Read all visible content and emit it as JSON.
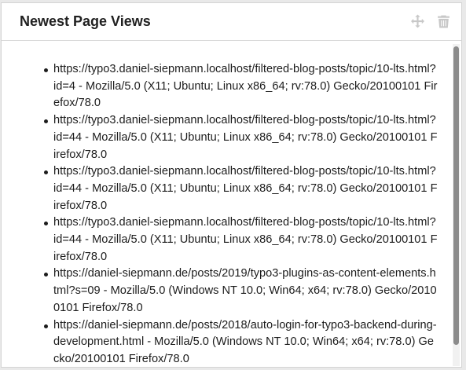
{
  "widget": {
    "title": "Newest Page Views",
    "actions": [
      {
        "name": "move",
        "icon": "move-icon"
      },
      {
        "name": "remove",
        "icon": "trash-icon"
      }
    ]
  },
  "entries": [
    "https://typo3.daniel-siepmann.localhost/filtered-blog-posts/topic/10-lts.html?id=4 - Mozilla/5.0 (X11; Ubuntu; Linux x86_64; rv:78.0) Gecko/20100101 Firefox/78.0",
    "https://typo3.daniel-siepmann.localhost/filtered-blog-posts/topic/10-lts.html?id=44 - Mozilla/5.0 (X11; Ubuntu; Linux x86_64; rv:78.0) Gecko/20100101 Firefox/78.0",
    "https://typo3.daniel-siepmann.localhost/filtered-blog-posts/topic/10-lts.html?id=44 - Mozilla/5.0 (X11; Ubuntu; Linux x86_64; rv:78.0) Gecko/20100101 Firefox/78.0",
    "https://typo3.daniel-siepmann.localhost/filtered-blog-posts/topic/10-lts.html?id=44 - Mozilla/5.0 (X11; Ubuntu; Linux x86_64; rv:78.0) Gecko/20100101 Firefox/78.0",
    "https://daniel-siepmann.de/posts/2019/typo3-plugins-as-content-elements.html?s=09 - Mozilla/5.0 (Windows NT 10.0; Win64; x64; rv:78.0) Gecko/20100101 Firefox/78.0",
    "https://daniel-siepmann.de/posts/2018/auto-login-for-typo3-backend-during-development.html - Mozilla/5.0 (Windows NT 10.0; Win64; x64; rv:78.0) Gecko/20100101 Firefox/78.0"
  ],
  "colors": {
    "text": "#1c1c1c",
    "title": "#212121",
    "icon": "#c8c8c8",
    "scrollbar_thumb": "#8c8c8c"
  }
}
